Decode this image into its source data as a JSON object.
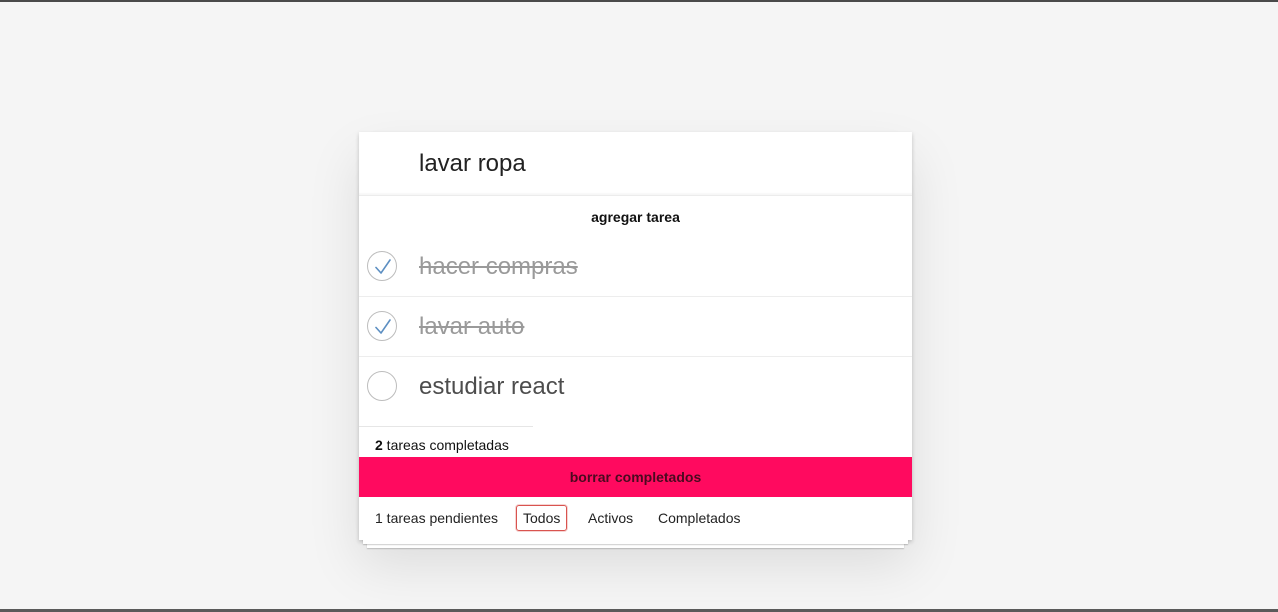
{
  "new_todo": {
    "value": "lavar ropa"
  },
  "add_button": {
    "label": "agregar tarea"
  },
  "todos": [
    {
      "text": "hacer compras",
      "completed": true
    },
    {
      "text": "lavar auto",
      "completed": true
    },
    {
      "text": "estudiar react",
      "completed": false
    }
  ],
  "completed_summary": {
    "count": "2",
    "label": " tareas completadas"
  },
  "clear_button": {
    "label": "borrar completados"
  },
  "footer": {
    "pending_text": "1 tareas pendientes",
    "filters": [
      {
        "label": "Todos",
        "selected": true
      },
      {
        "label": "Activos",
        "selected": false
      },
      {
        "label": "Completados",
        "selected": false
      }
    ]
  },
  "colors": {
    "background": "#f5f5f5",
    "clear_button_bg": "#ff0a5f",
    "check_color": "#5d8fc2",
    "selected_filter_border": "#d9534f"
  }
}
